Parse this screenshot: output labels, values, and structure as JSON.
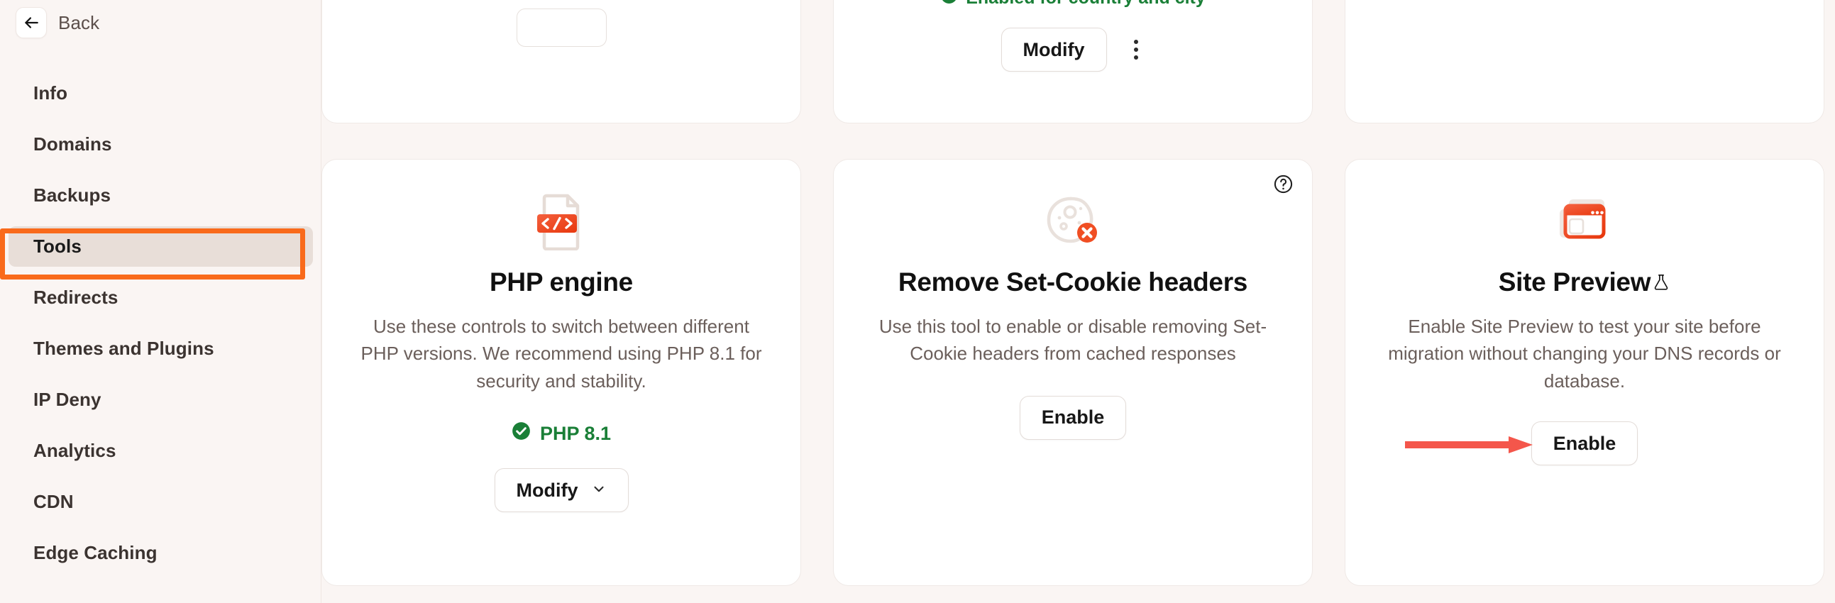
{
  "sidebar": {
    "back": {
      "label": "Back",
      "icon": "arrow-left-icon"
    },
    "items": [
      {
        "label": "Info",
        "active": false
      },
      {
        "label": "Domains",
        "active": false
      },
      {
        "label": "Backups",
        "active": false
      },
      {
        "label": "Tools",
        "active": true
      },
      {
        "label": "Redirects",
        "active": false
      },
      {
        "label": "Themes and Plugins",
        "active": false
      },
      {
        "label": "IP Deny",
        "active": false
      },
      {
        "label": "Analytics",
        "active": false
      },
      {
        "label": "CDN",
        "active": false
      },
      {
        "label": "Edge Caching",
        "active": false
      }
    ]
  },
  "annotations": {
    "highlight_color": "#F96A1B",
    "arrow_color": "#F4564B",
    "highlighted_item": "Tools",
    "arrow_target": "Enable"
  },
  "top_row": {
    "card_2": {
      "status_text": "Enabled for country and city",
      "status_color": "#1A7F37",
      "modify_label": "Modify",
      "kebab_icon": "more-vertical-icon"
    }
  },
  "cards": [
    {
      "id": "php-engine",
      "icon": "code-file-icon",
      "title": "PHP engine",
      "description": "Use these controls to switch between different PHP versions. We recommend using PHP 8.1 for security and stability.",
      "status": "PHP 8.1",
      "status_color": "#1A7F37",
      "status_icon": "check-circle-icon",
      "action_label": "Modify",
      "action_icon": "chevron-down-icon",
      "help_icon": null
    },
    {
      "id": "remove-set-cookie-headers",
      "icon": "cookie-blocked-icon",
      "title": "Remove Set-Cookie headers",
      "description": "Use this tool to enable or disable removing Set-Cookie headers from cached responses",
      "status": null,
      "action_label": "Enable",
      "action_icon": null,
      "help_icon": "help-circle-icon"
    },
    {
      "id": "site-preview",
      "icon": "browser-windows-icon",
      "title": "Site Preview",
      "title_badge_icon": "flask-icon",
      "description": "Enable Site Preview to test your site before migration without changing your DNS records or database.",
      "status": null,
      "action_label": "Enable",
      "action_icon": null,
      "help_icon": null
    }
  ]
}
